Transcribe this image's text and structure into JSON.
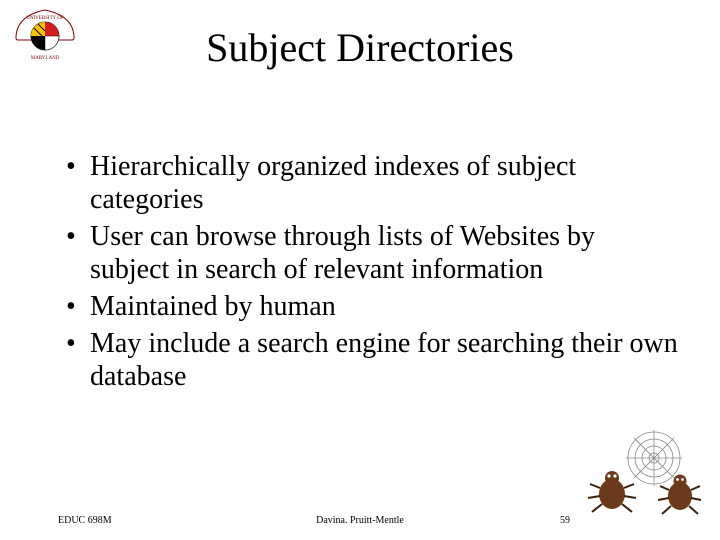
{
  "title": "Subject Directories",
  "bullets": [
    "Hierarchically organized indexes of subject categories",
    "User can browse through lists of Websites by subject in search of relevant information",
    "Maintained by human",
    "May include a search engine for searching their own database"
  ],
  "footer": {
    "course": "EDUC 698M",
    "author": "Davina. Pruitt-Mentle",
    "page": "59"
  },
  "logo_alt": "University of Maryland seal",
  "clipart_alt": "Two cartoon beetles with a spider web"
}
